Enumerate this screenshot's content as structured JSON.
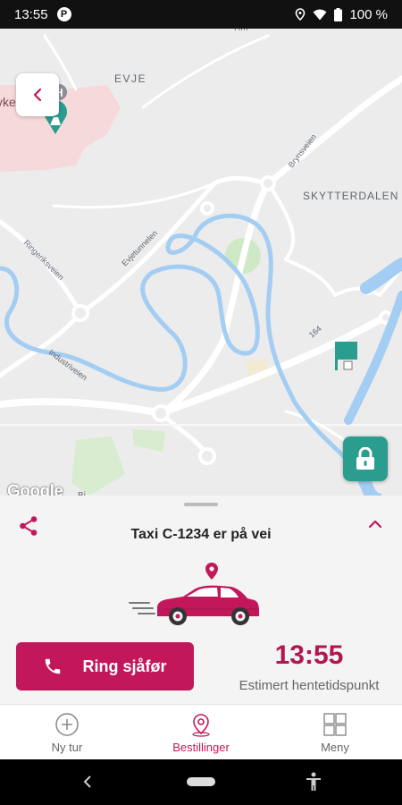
{
  "status_bar": {
    "time": "13:55",
    "app_badge": "P",
    "battery": "100 %"
  },
  "map": {
    "labels": {
      "evje": "EVJE",
      "sykehus": "ykehus",
      "skytterdalen": "SKYTTERDALEN",
      "brynsveien": "Brynsveien",
      "ringeriksveien": "Ringeriksveien",
      "evjetunnelen": "Evjetunnelen",
      "industriveien": "Industriveien",
      "road_164": "164",
      "hospital_marker": "H",
      "partial_bottom": "Bi",
      "partial_top": "Hm"
    },
    "attribution": "Google"
  },
  "sheet": {
    "status_title": "Taxi C-1234 er på vei"
  },
  "call_button": {
    "label": "Ring sjåfør"
  },
  "eta": {
    "time": "13:55",
    "label": "Estimert hentetidspunkt"
  },
  "nav": {
    "items": [
      {
        "label": "Ny tur",
        "icon": "plus-circle-icon",
        "active": false
      },
      {
        "label": "Bestillinger",
        "icon": "location-pin-icon",
        "active": true
      },
      {
        "label": "Meny",
        "icon": "grid-icon",
        "active": false
      }
    ]
  },
  "colors": {
    "brand": "#c2185b",
    "teal": "#2a9d8f",
    "water": "#a3cdf2"
  }
}
